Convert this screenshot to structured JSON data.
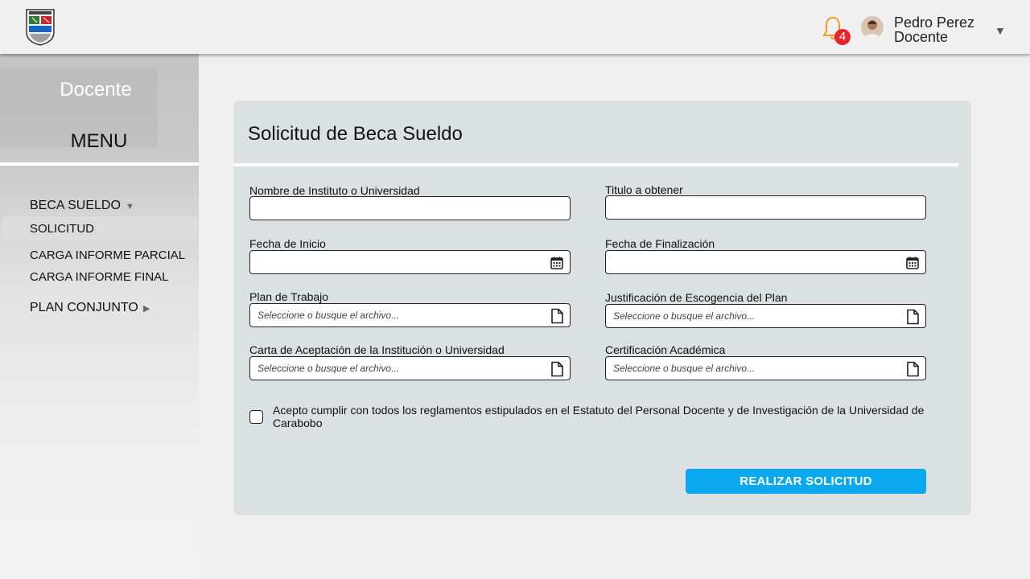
{
  "header": {
    "logo_icon": "university-crest-logo",
    "notifications": {
      "icon": "bell-icon",
      "count": "4",
      "badge_color": "#e8232a",
      "icon_color": "#f59a1f"
    },
    "user": {
      "name": "Pedro Perez",
      "role": "Docente",
      "caret": "▼"
    }
  },
  "sidebar": {
    "role": "Docente",
    "menu_title": "MENU",
    "groups": [
      {
        "label": "BECA SUELDO",
        "indicator": "▼",
        "items": [
          "SOLICITUD",
          "CARGA INFORME PARCIAL",
          "CARGA INFORME FINAL"
        ],
        "active_item": "SOLICITUD"
      },
      {
        "label": "PLAN CONJUNTO",
        "indicator": "▶"
      }
    ]
  },
  "form": {
    "title": "Solicitud de Beca Sueldo",
    "fields": {
      "institution": {
        "label": "Nombre de Instituto o Universidad",
        "value": "",
        "placeholder": ""
      },
      "degree": {
        "label": "Titulo a obtener",
        "value": "",
        "placeholder": ""
      },
      "start_date": {
        "label": "Fecha de Inicio",
        "value": "",
        "placeholder": "",
        "icon": "calendar-icon"
      },
      "end_date": {
        "label": "Fecha de Finalización",
        "value": "",
        "placeholder": "",
        "icon": "calendar-icon"
      },
      "work_plan": {
        "label": "Plan de Trabajo",
        "placeholder": "Seleccione o busque el archivo...",
        "icon": "file-icon"
      },
      "justification": {
        "label": "Justificación de Escogencia del Plan",
        "placeholder": "Seleccione o busque el archivo...",
        "icon": "file-icon"
      },
      "acceptance_letter": {
        "label": "Carta de Aceptación de la Institución o Universidad",
        "placeholder": "Seleccione o busque el archivo...",
        "icon": "file-icon"
      },
      "academic_cert": {
        "label": "Certificación Académica",
        "placeholder": "Seleccione o busque el archivo...",
        "icon": "file-icon"
      }
    },
    "agreement": {
      "text": "Acepto cumplir con todos los reglamentos estipulados en el Estatuto del Personal Docente y de Investigación de la Universidad de Carabobo",
      "checked": false
    },
    "submit_label": "REALIZAR SOLICITUD",
    "accent_color": "#0aa9ef"
  }
}
